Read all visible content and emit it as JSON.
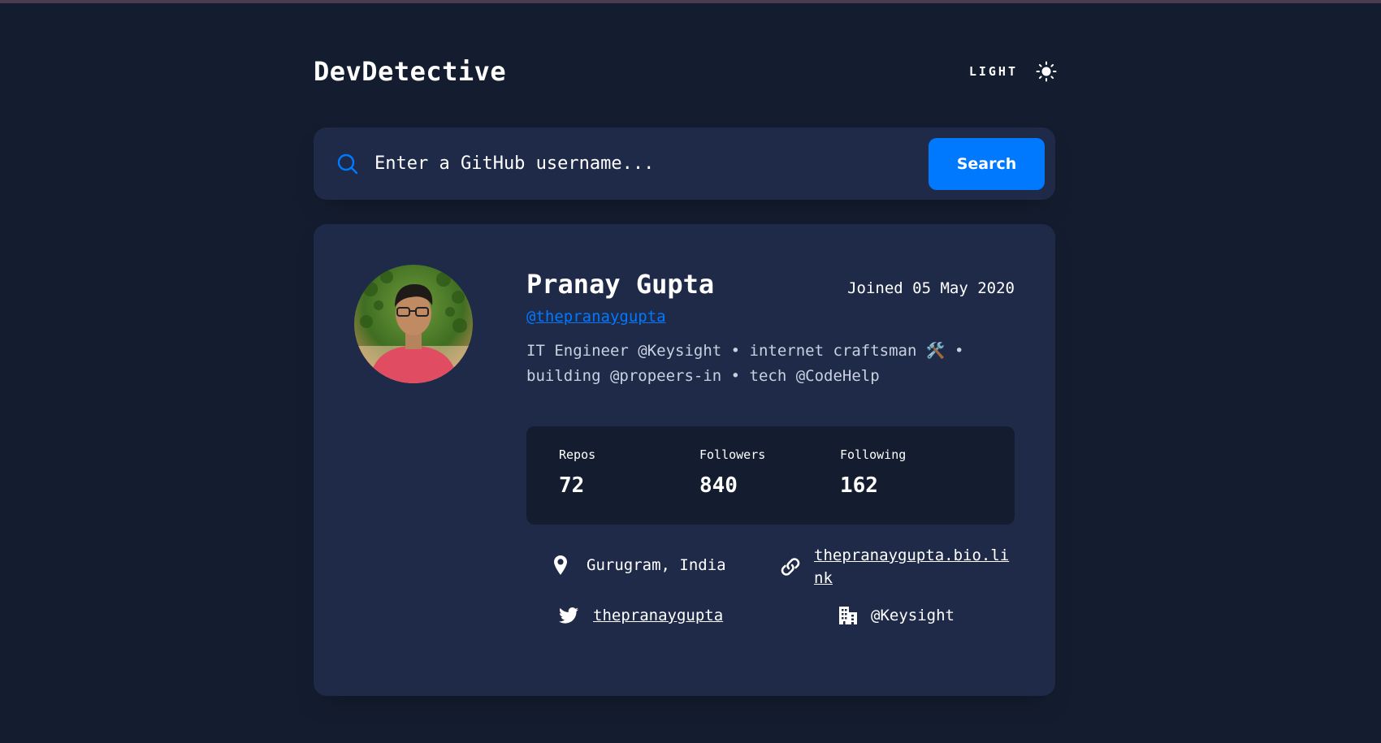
{
  "header": {
    "logo": "DevDetective",
    "theme_label": "LIGHT",
    "theme_icon": "sun-icon"
  },
  "search": {
    "placeholder": "Enter a GitHub username...",
    "button_label": "Search",
    "icon": "search-icon"
  },
  "profile": {
    "name": "Pranay Gupta",
    "joined": "Joined 05 May 2020",
    "handle": "@thepranaygupta",
    "bio": "IT Engineer @Keysight • internet craftsman 🛠️ • building @propeers-in • tech @CodeHelp",
    "stats": [
      {
        "label": "Repos",
        "value": "72"
      },
      {
        "label": "Followers",
        "value": "840"
      },
      {
        "label": "Following",
        "value": "162"
      }
    ],
    "location": "Gurugram, India",
    "blog": "thepranaygupta.bio.link",
    "twitter": "thepranaygupta",
    "company": "@Keysight"
  },
  "colors": {
    "background": "#141d2f",
    "card": "#1e2a47",
    "accent": "#0079ff",
    "text": "#ffffff"
  }
}
